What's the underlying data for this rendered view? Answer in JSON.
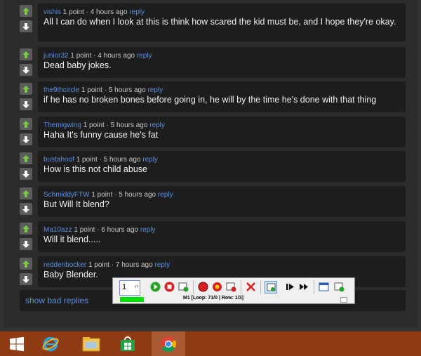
{
  "comments": [
    {
      "author": "vishis",
      "meta": "1 point · 4 hours ago",
      "reply": "reply",
      "text": "All I can do when I look at this is think how scared the kid must be, and I hope they're okay."
    },
    {
      "author": "junior32",
      "meta": "1 point · 4 hours ago",
      "reply": "reply",
      "text": "Dead baby jokes."
    },
    {
      "author": "the9thcircle",
      "meta": "1 point · 5 hours ago",
      "reply": "reply",
      "text": "if he has no broken bones before going in, he will by the time he's done with that thing"
    },
    {
      "author": "Themigwing",
      "meta": "1 point · 5 hours ago",
      "reply": "reply",
      "text": "Haha It's funny cause he's fat"
    },
    {
      "author": "bustahoof",
      "meta": "1 point · 5 hours ago",
      "reply": "reply",
      "text": "How is this not child abuse"
    },
    {
      "author": "SchmiddyFTW",
      "meta": "1 point · 5 hours ago",
      "reply": "reply",
      "text": "But Will It blend?"
    },
    {
      "author": "Ma10azz",
      "meta": "1 point · 6 hours ago",
      "reply": "reply",
      "text": "Will it blend....."
    },
    {
      "author": "reddenbocker",
      "meta": "1 point · 7 hours ago",
      "reply": "reply",
      "text": "Baby Blender."
    }
  ],
  "bad_replies_label": "show bad replies",
  "macro_toolbar": {
    "spin_value": "1",
    "status_text": "M1 [Loop: 71/0 | Row: 1/3]",
    "progress": 1.0
  },
  "taskbar": {
    "items": [
      "start",
      "internet-explorer",
      "file-explorer",
      "store",
      "chrome"
    ],
    "active": "chrome"
  },
  "colors": {
    "accent_link": "#5b8fe0",
    "vote_green": "#7ac943",
    "taskbar": "#8f3b16"
  }
}
